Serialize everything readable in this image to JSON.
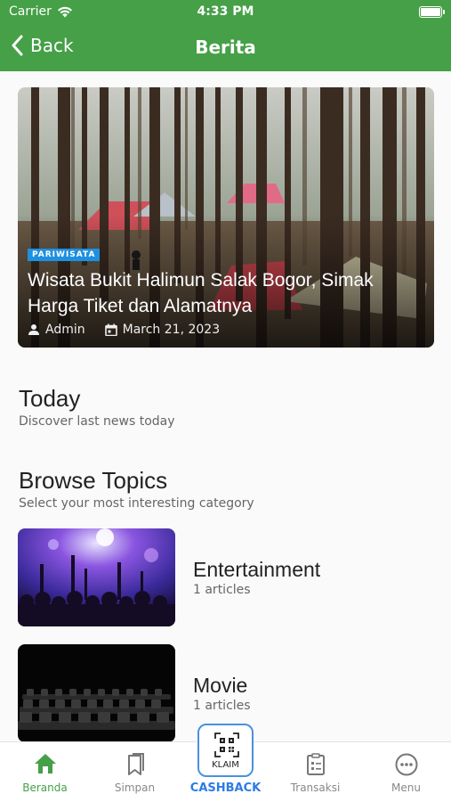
{
  "status_bar": {
    "carrier": "Carrier",
    "time": "4:33 PM"
  },
  "nav": {
    "back_label": "Back",
    "title": "Berita"
  },
  "hero": {
    "category": "PARIWISATA",
    "headline": "Wisata Bukit Halimun Salak Bogor, Simak Harga Tiket dan Alamatnya",
    "author": "Admin",
    "date": "March 21, 2023"
  },
  "today": {
    "title": "Today",
    "subtitle": "Discover last news today"
  },
  "browse": {
    "title": "Browse Topics",
    "subtitle": "Select your most interesting category"
  },
  "topics": [
    {
      "name": "Entertainment",
      "count": "1 articles"
    },
    {
      "name": "Movie",
      "count": "1 articles"
    }
  ],
  "tabbar": {
    "items": [
      {
        "label": "Beranda",
        "icon": "home-icon"
      },
      {
        "label": "Simpan",
        "icon": "bookmark-icon"
      },
      {
        "label": "CASHBACK",
        "icon": "qr-code-icon"
      },
      {
        "label": "Transaksi",
        "icon": "receipt-icon"
      },
      {
        "label": "Menu",
        "icon": "more-icon"
      }
    ],
    "klaim_label": "KLAIM"
  },
  "colors": {
    "primary": "#45a047",
    "accent_blue": "#2c7be5",
    "category_badge": "#1e90e0"
  }
}
